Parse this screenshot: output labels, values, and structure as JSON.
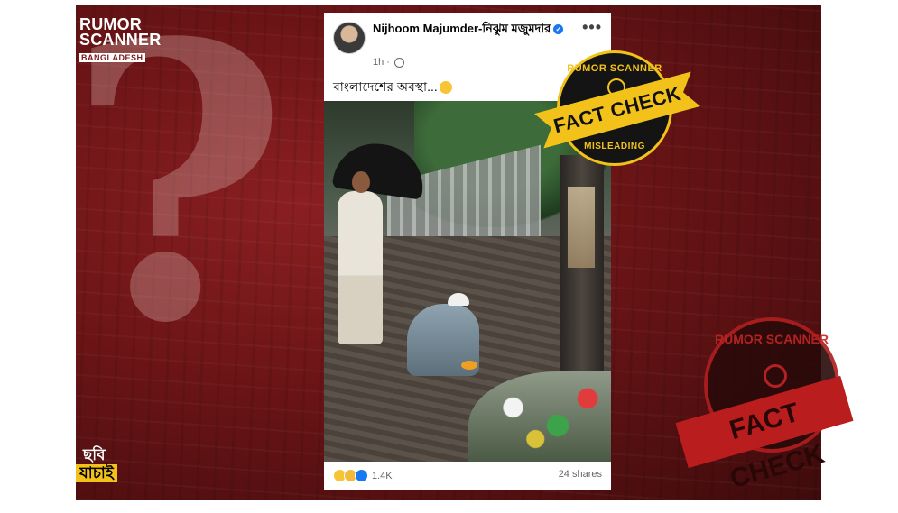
{
  "background": {
    "brand_logo": {
      "line1": "RUMOR",
      "line2": "SCANNER",
      "line3": "BANGLADESH"
    },
    "chobi_logo": {
      "line1": "ছবি",
      "line2": "যাচাই"
    },
    "question_mark": "?",
    "stamp": {
      "top_text": "RUMOR SCANNER",
      "ribbon_text": "FACT CHECK"
    }
  },
  "post": {
    "author_name": "Nijhoom Majumder-নিঝুম মজুমদার",
    "verified": true,
    "time": "1h",
    "menu": "•••",
    "caption": "বাংলাদেশের অবস্থা...",
    "reactions": {
      "types": [
        "haha",
        "sad",
        "like"
      ],
      "count": "1.4K"
    },
    "shares": "24 shares"
  },
  "badge": {
    "top_text": "RUMOR SCANNER",
    "ribbon_text": "FACT CHECK",
    "verdict": "MISLEADING"
  },
  "colors": {
    "brand_red": "#7a1a1a",
    "badge_yellow": "#f2c21a",
    "facebook_blue": "#1877f2"
  }
}
